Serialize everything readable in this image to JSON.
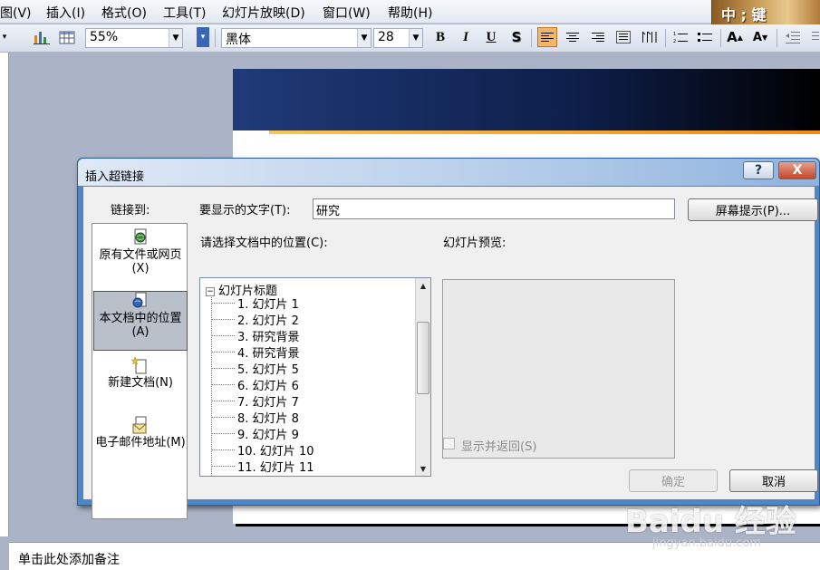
{
  "menu": {
    "items": [
      "图(V)",
      "插入(I)",
      "格式(O)",
      "工具(T)",
      "幻灯片放映(D)",
      "窗口(W)",
      "帮助(H)"
    ],
    "banner_text": "中 ; 键"
  },
  "toolbar": {
    "zoom": "55%",
    "font": "黑体",
    "font_size": "28",
    "bold": "B",
    "italic": "I",
    "underline": "U",
    "shadow": "S",
    "grow_font": "A",
    "shrink_font": "A"
  },
  "dialog": {
    "title": "插入超链接",
    "help": "?",
    "close": "X",
    "link_to_label": "链接到:",
    "link_items": [
      {
        "label": "原有文件或网页(X)",
        "icon": "web-page-icon"
      },
      {
        "label": "本文档中的位置(A)",
        "icon": "document-place-icon"
      },
      {
        "label": "新建文档(N)",
        "icon": "new-document-icon"
      },
      {
        "label": "电子邮件地址(M)",
        "icon": "email-icon"
      }
    ],
    "display_text_label": "要显示的文字(T):",
    "display_text_value": "研究",
    "screen_tip_button": "屏幕提示(P)...",
    "select_place_label": "请选择文档中的位置(C):",
    "tree_root": "幻灯片标题",
    "tree_items": [
      "1. 幻灯片 1",
      "2. 幻灯片 2",
      "3. 研究背景",
      "4. 研究背景",
      "5. 幻灯片 5",
      "6. 幻灯片 6",
      "7. 幻灯片 7",
      "8. 幻灯片 8",
      "9. 幻灯片 9",
      "10. 幻灯片 10",
      "11. 幻灯片 11"
    ],
    "preview_label": "幻灯片预览:",
    "show_and_return_label": "显示并返回(S)",
    "ok_button": "确定",
    "cancel_button": "取消"
  },
  "notes_placeholder": "单击此处添加备注",
  "watermark": {
    "logo": "Baidu 经验",
    "url": "jingyan.baidu.com"
  },
  "colors": {
    "selected_align": "#f4b66d",
    "dialog_frame": "#4e86c6",
    "close_button": "#c3472b"
  }
}
